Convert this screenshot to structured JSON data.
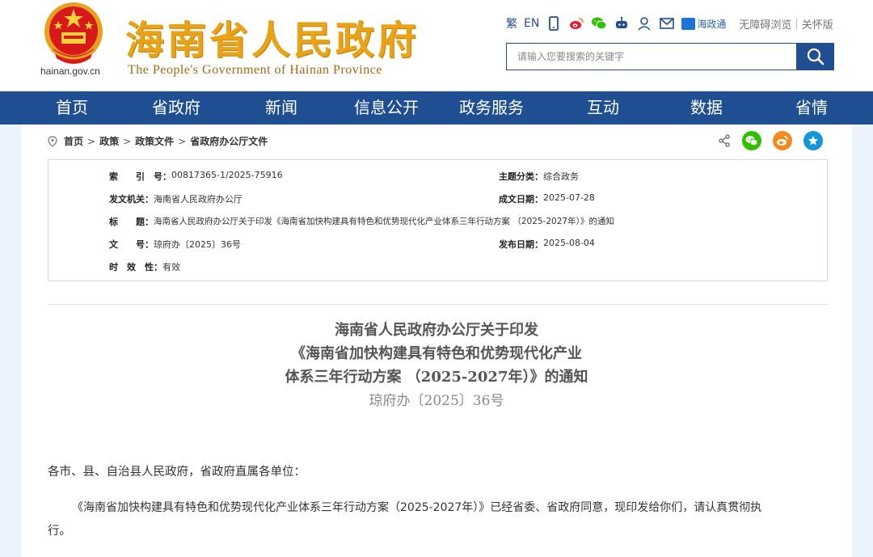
{
  "header": {
    "domain": "hainan.gov.cn",
    "title": "海南省人民政府",
    "subtitle": "The People's Government  of Hainan Province",
    "toolbar": {
      "traditional": "繁",
      "english": "EN",
      "haizhengtong": "海政通",
      "accessibility": "无障碍浏览",
      "separator": "|",
      "elderly": "关怀版"
    },
    "search_placeholder": "请输入您要搜索的关键字"
  },
  "nav": {
    "items": [
      "首页",
      "省政府",
      "新闻",
      "信息公开",
      "政务服务",
      "互动",
      "数据",
      "省情"
    ]
  },
  "breadcrumb": {
    "items": [
      "首页",
      "政策",
      "政策文件",
      "省政府办公厅文件"
    ],
    "separator": ">"
  },
  "meta": {
    "index_label": "索　　引　号：",
    "index_value": "00817365-1/2025-75916",
    "category_label": "主题分类：",
    "category_value": "综合政务",
    "issuer_label": "发文机关：",
    "issuer_value": "海南省人民政府办公厅",
    "created_label": "成文日期：",
    "created_value": "2025-07-28",
    "title_label": "标　　题：",
    "title_value": "海南省人民政府办公厅关于印发《海南省加快构建具有特色和优势现代化产业体系三年行动方案 （2025-2027年）》的通知",
    "number_label": "文　　号：",
    "number_value": "琼府办〔2025〕36号",
    "published_label": "发布日期：",
    "published_value": "2025-08-04",
    "validity_label": "时　效　性：",
    "validity_value": "有效"
  },
  "document": {
    "title_line1": "海南省人民政府办公厅关于印发",
    "title_line2": "《海南省加快构建具有特色和优势现代化产业",
    "title_line3": "体系三年行动方案 （2025-2027年）》的通知",
    "doc_number": "琼府办〔2025〕36号",
    "salutation": "各市、县、自治县人民政府，省政府直属各单位：",
    "paragraph1_line1": "《海南省加快构建具有特色和优势现代化产业体系三年行动方案（2025-2027年）》已经省委、省政府同意，现印发给你们，请认真贯彻执",
    "paragraph1_line2": "行。"
  },
  "colors": {
    "nav_bg": "#1f4f92",
    "title_gold": "#e8a317",
    "emblem_red": "#d7191c",
    "wechat_green": "#2dc100",
    "weibo_orange": "#f5891f",
    "star_blue": "#1296db"
  }
}
